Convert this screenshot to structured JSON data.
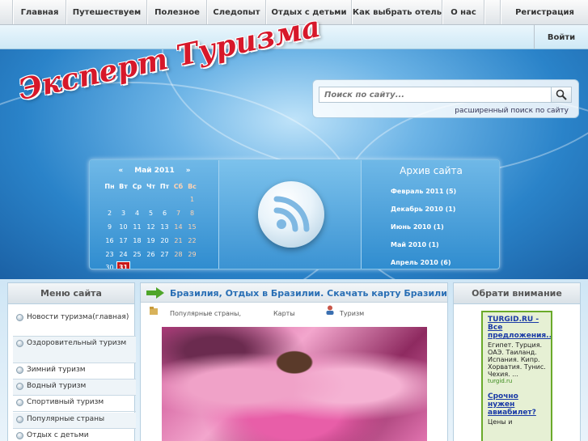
{
  "nav": {
    "items": [
      "Главная",
      "Путешествуем",
      "Полезное",
      "Следопыт",
      "Отдых с детьми",
      "Как выбрать отель",
      "О нас",
      "Регистрация"
    ],
    "login": "Войти"
  },
  "header": {
    "logo": "Эксперт Туризма",
    "search_placeholder": "Поиск по сайту...",
    "advanced_search": "расширенный поиск по сайту"
  },
  "calendar": {
    "prev": "«",
    "month": "Май 2011",
    "next": "»",
    "weekdays": [
      "Пн",
      "Вт",
      "Ср",
      "Чт",
      "Пт",
      "Сб",
      "Вс"
    ],
    "today": 31
  },
  "archive": {
    "title": "Архив сайта",
    "items": [
      "Февраль 2011 (5)",
      "Декабрь 2010 (1)",
      "Июнь 2010 (1)",
      "Май 2010 (1)",
      "Апрель 2010 (6)"
    ]
  },
  "menu": {
    "title": "Меню сайта",
    "items": [
      "Новости туризма(главная)",
      "Оздоровительный туризм",
      "Зимний туризм",
      "Водный туризм",
      "Спортивный туризм",
      "Популярные страны",
      "Отдых с детьми"
    ]
  },
  "article": {
    "title": "Бразилия, Отдых в Бразилии. Скачать карту Бразилии.",
    "category": "Популярные страны,",
    "category2": "Карты",
    "author": "Туризм"
  },
  "attention": {
    "title": "Обрати внимание",
    "ad1_title": "TURGID.RU - Все предложения...",
    "ad1_text": "Египет. Турция. ОАЭ. Таиланд. Испания. Кипр. Хорватия. Тунис. Чехия. ...",
    "ad1_source": "turgid.ru",
    "ad2_title": "Срочно нужен авиабилет?",
    "ad2_text": "Цены и"
  },
  "colors": {
    "accent": "#2a6fb5",
    "today": "#c81818",
    "logo": "#d7182a"
  }
}
